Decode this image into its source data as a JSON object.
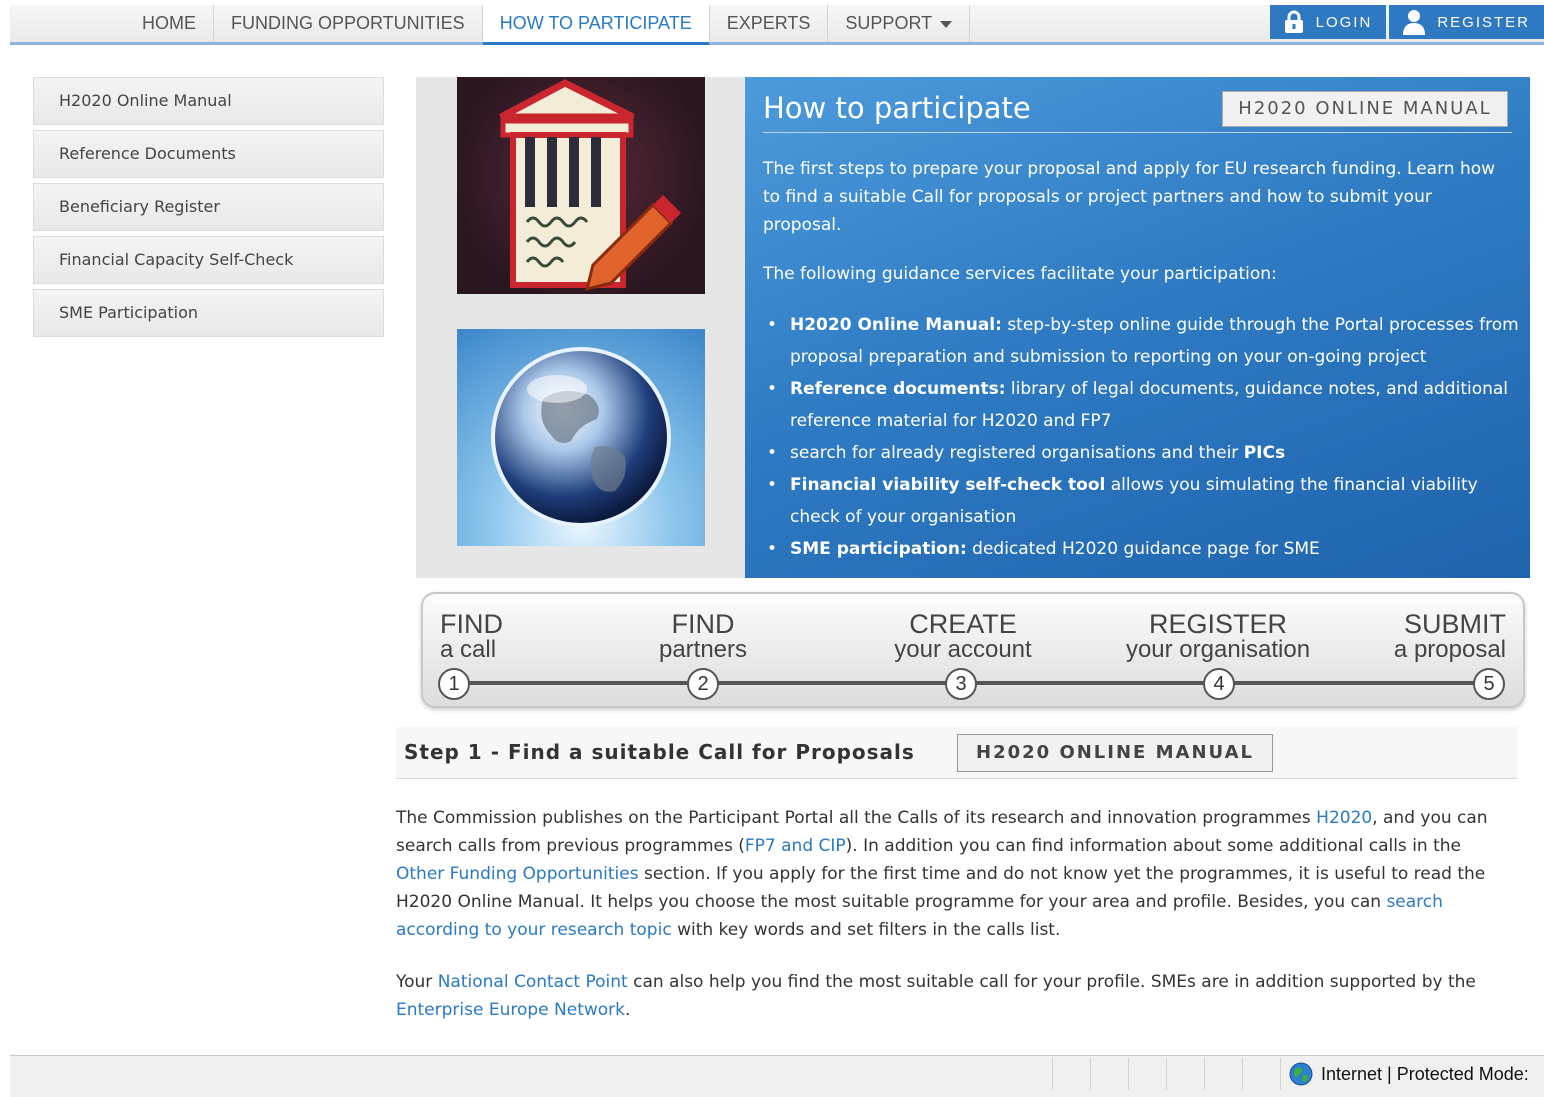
{
  "nav": {
    "items": [
      "HOME",
      "FUNDING OPPORTUNITIES",
      "HOW TO PARTICIPATE",
      "EXPERTS",
      "SUPPORT"
    ],
    "active": "HOW TO PARTICIPATE",
    "login": "LOGIN",
    "register": "REGISTER"
  },
  "sidebar": {
    "items": [
      "H2020 Online Manual",
      "Reference Documents",
      "Beneficiary Register",
      "Financial Capacity Self-Check",
      "SME Participation"
    ]
  },
  "hero": {
    "title": "How to participate",
    "manual_button": "H2020 ONLINE MANUAL",
    "intro": "The first steps to prepare your proposal and apply for EU research funding. Learn how to find a suitable Call for proposals or project partners and how to submit your proposal.",
    "lead": "The following guidance services facilitate your participation:",
    "bullets": [
      {
        "bold": "H2020 Online Manual:",
        "text": " step-by-step online guide through the Portal processes from proposal preparation and submission to reporting on your on-going project"
      },
      {
        "bold": "Reference documents:",
        "text": " library of legal documents, guidance notes, and additional reference material for H2020 and FP7"
      },
      {
        "pre": "search for already registered organisations and their ",
        "bold": "PICs"
      },
      {
        "bold": "Financial viability self-check tool",
        "text": " allows you simulating the financial viability check of your organisation"
      },
      {
        "bold": "SME participation:",
        "text": " dedicated H2020 guidance page for SME"
      }
    ]
  },
  "steps": [
    {
      "big": "FIND",
      "small": "a call",
      "num": "1"
    },
    {
      "big": "FIND",
      "small": "partners",
      "num": "2"
    },
    {
      "big": "CREATE",
      "small": "your account",
      "num": "3"
    },
    {
      "big": "REGISTER",
      "small": "your organisation",
      "num": "4"
    },
    {
      "big": "SUBMIT",
      "small": "a proposal",
      "num": "5"
    }
  ],
  "step1": {
    "title": "Step 1 - Find a suitable Call for Proposals",
    "manual_button": "H2020 ONLINE MANUAL",
    "p1": {
      "t1": "The Commission publishes on the Participant Portal all the Calls of its research and innovation programmes ",
      "l1": "H2020",
      "t2": ", and you can search calls from previous programmes (",
      "l2": "FP7 and CIP",
      "t3": "). In addition you can find information about some additional calls in the ",
      "l3": "Other Funding Opportunities",
      "t4": " section. If you apply for the first time and do not know yet the programmes, it is useful to read the H2020 Online Manual. It helps you choose the most suitable programme for your area and profile. Besides, you can ",
      "l4": "search according to your research topic",
      "t5": " with key words and set filters in the calls list."
    },
    "p2": {
      "t1": "Your ",
      "l1": "National Contact Point",
      "t2": " can also help you find the most suitable call for your profile. SMEs are in addition supported by the ",
      "l2": "Enterprise Europe Network",
      "t3": "."
    }
  },
  "statusbar": {
    "zone": "Internet | Protected Mode:"
  }
}
